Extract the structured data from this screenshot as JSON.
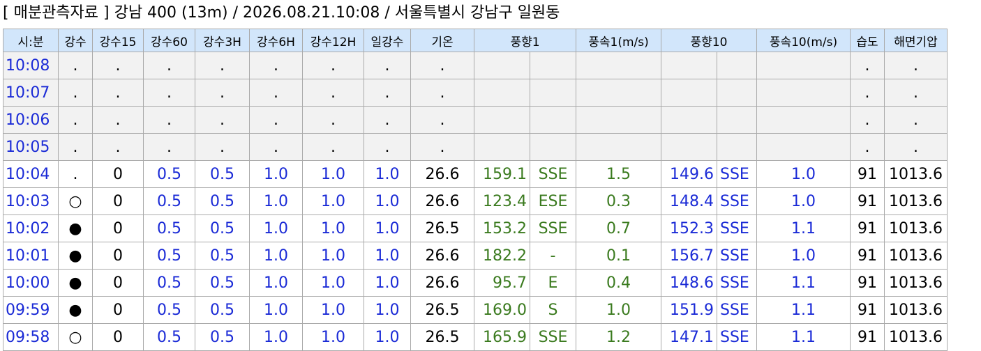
{
  "title": "[ 매분관측자료 ] 강남 400 (13m) / 2026.08.21.10:08 / 서울특별시 강남구 일원동",
  "headers": [
    "시:분",
    "강수",
    "강수15",
    "강수60",
    "강수3H",
    "강수6H",
    "강수12H",
    "일강수",
    "기온",
    "풍향1",
    "풍속1(m/s)",
    "풍향10",
    "풍속10(m/s)",
    "습도",
    "해면기압"
  ],
  "rows": [
    {
      "time": "10:08",
      "rain": ".",
      "r15": ".",
      "r60": ".",
      "r3h": ".",
      "r6h": ".",
      "r12h": ".",
      "rday": ".",
      "temp": ".",
      "wd1": "",
      "wd1dir": "",
      "ws1": "",
      "wd10": "",
      "wd10dir": "",
      "ws10": "",
      "hum": ".",
      "pres": ".",
      "empty": true
    },
    {
      "time": "10:07",
      "rain": ".",
      "r15": ".",
      "r60": ".",
      "r3h": ".",
      "r6h": ".",
      "r12h": ".",
      "rday": ".",
      "temp": ".",
      "wd1": "",
      "wd1dir": "",
      "ws1": "",
      "wd10": "",
      "wd10dir": "",
      "ws10": "",
      "hum": ".",
      "pres": ".",
      "empty": true
    },
    {
      "time": "10:06",
      "rain": ".",
      "r15": ".",
      "r60": ".",
      "r3h": ".",
      "r6h": ".",
      "r12h": ".",
      "rday": ".",
      "temp": ".",
      "wd1": "",
      "wd1dir": "",
      "ws1": "",
      "wd10": "",
      "wd10dir": "",
      "ws10": "",
      "hum": ".",
      "pres": ".",
      "empty": true
    },
    {
      "time": "10:05",
      "rain": ".",
      "r15": ".",
      "r60": ".",
      "r3h": ".",
      "r6h": ".",
      "r12h": ".",
      "rday": ".",
      "temp": ".",
      "wd1": "",
      "wd1dir": "",
      "ws1": "",
      "wd10": "",
      "wd10dir": "",
      "ws10": "",
      "hum": ".",
      "pres": ".",
      "empty": true
    },
    {
      "time": "10:04",
      "rain": ".",
      "r15": "0",
      "r60": "0.5",
      "r3h": "0.5",
      "r6h": "1.0",
      "r12h": "1.0",
      "rday": "1.0",
      "temp": "26.6",
      "wd1": "159.1",
      "wd1dir": "SSE",
      "ws1": "1.5",
      "wd10": "149.6",
      "wd10dir": "SSE",
      "ws10": "1.0",
      "hum": "91",
      "pres": "1013.6"
    },
    {
      "time": "10:03",
      "rain": "○",
      "r15": "0",
      "r60": "0.5",
      "r3h": "0.5",
      "r6h": "1.0",
      "r12h": "1.0",
      "rday": "1.0",
      "temp": "26.6",
      "wd1": "123.4",
      "wd1dir": "ESE",
      "ws1": "0.3",
      "wd10": "148.4",
      "wd10dir": "SSE",
      "ws10": "1.0",
      "hum": "91",
      "pres": "1013.6"
    },
    {
      "time": "10:02",
      "rain": "●",
      "r15": "0",
      "r60": "0.5",
      "r3h": "0.5",
      "r6h": "1.0",
      "r12h": "1.0",
      "rday": "1.0",
      "temp": "26.5",
      "wd1": "153.2",
      "wd1dir": "SSE",
      "ws1": "0.7",
      "wd10": "152.3",
      "wd10dir": "SSE",
      "ws10": "1.1",
      "hum": "91",
      "pres": "1013.6"
    },
    {
      "time": "10:01",
      "rain": "●",
      "r15": "0",
      "r60": "0.5",
      "r3h": "0.5",
      "r6h": "1.0",
      "r12h": "1.0",
      "rday": "1.0",
      "temp": "26.6",
      "wd1": "182.2",
      "wd1dir": "-",
      "ws1": "0.1",
      "wd10": "156.7",
      "wd10dir": "SSE",
      "ws10": "1.0",
      "hum": "91",
      "pres": "1013.6"
    },
    {
      "time": "10:00",
      "rain": "●",
      "r15": "0",
      "r60": "0.5",
      "r3h": "0.5",
      "r6h": "1.0",
      "r12h": "1.0",
      "rday": "1.0",
      "temp": "26.6",
      "wd1": "95.7",
      "wd1dir": "E",
      "ws1": "0.4",
      "wd10": "148.6",
      "wd10dir": "SSE",
      "ws10": "1.1",
      "hum": "91",
      "pres": "1013.6"
    },
    {
      "time": "09:59",
      "rain": "●",
      "r15": "0",
      "r60": "0.5",
      "r3h": "0.5",
      "r6h": "1.0",
      "r12h": "1.0",
      "rday": "1.0",
      "temp": "26.5",
      "wd1": "169.0",
      "wd1dir": "S",
      "ws1": "1.0",
      "wd10": "151.9",
      "wd10dir": "SSE",
      "ws10": "1.1",
      "hum": "91",
      "pres": "1013.6"
    },
    {
      "time": "09:58",
      "rain": "○",
      "r15": "0",
      "r60": "0.5",
      "r3h": "0.5",
      "r6h": "1.0",
      "r12h": "1.0",
      "rday": "1.0",
      "temp": "26.5",
      "wd1": "165.9",
      "wd1dir": "SSE",
      "ws1": "1.2",
      "wd10": "147.1",
      "wd10dir": "SSE",
      "ws10": "1.1",
      "hum": "91",
      "pres": "1013.6"
    }
  ],
  "colors": {
    "header_bg": "#d2e6fb",
    "time": "#1a2ad6",
    "precip": "#1a2ad6",
    "wind1": "#3a7a1e",
    "wind10": "#1a2ad6",
    "ring": "#e0201a"
  }
}
